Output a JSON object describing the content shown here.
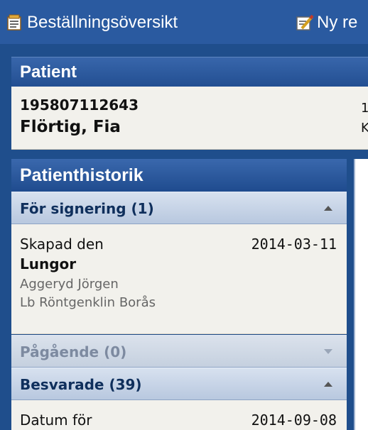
{
  "toolbar": {
    "overview_label": "Beställningsöversikt",
    "new_label": "Ny re",
    "overview_icon": "document-icon",
    "new_icon": "edit-document-icon"
  },
  "patient": {
    "header": "Patient",
    "id": "195807112643",
    "name": "Flörtig, Fia",
    "col2_line1": "1",
    "col2_line2": "K"
  },
  "history": {
    "header": "Patienthistorik",
    "sections": [
      {
        "label": "För signering (1)",
        "state": "expanded"
      },
      {
        "label": "Pågående (0)",
        "state": "disabled"
      },
      {
        "label": "Besvarade (39)",
        "state": "expanded"
      }
    ],
    "signing_item": {
      "label": "Skapad den",
      "date": "2014-03-11",
      "exam": "Lungor",
      "doctor": "Aggeryd Jörgen",
      "clinic": "Lb Röntgenklin Borås"
    },
    "answered_item": {
      "label": "Datum för",
      "date": "2014-09-08"
    }
  },
  "colors": {
    "background": "#1f4e8c",
    "toolbar": "#2a5aa0",
    "panel_bg": "#f2f1ec",
    "section_text": "#0f2f5c"
  }
}
